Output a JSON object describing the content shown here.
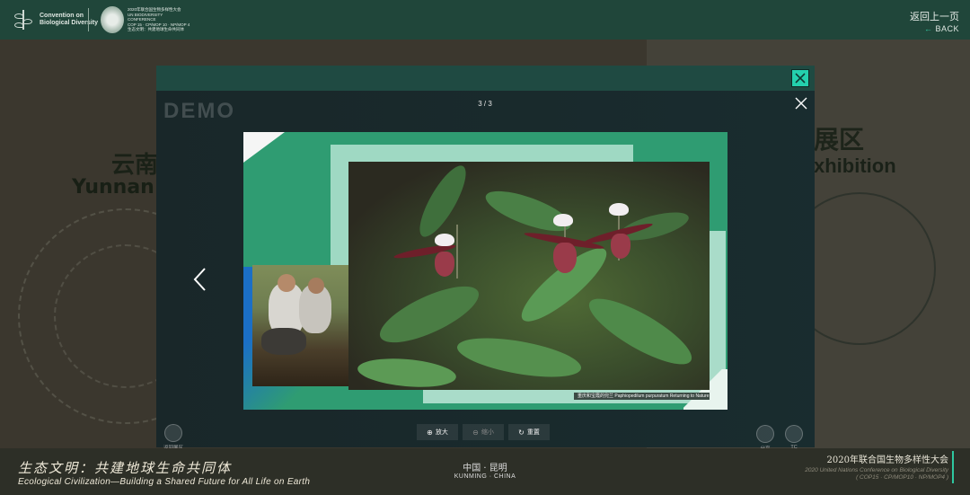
{
  "header": {
    "cbd_logo_text": [
      "Convention on",
      "Biological Diversity"
    ],
    "cop_logo_text": [
      "2020年联合国生物多样性大会",
      "UN BIODIVERSITY CONFERENCE",
      "COP 15 · CP/MOP 10 · NP/MOP 4",
      "生态文明：共建地球生命共同体"
    ],
    "back_cn": "返回上一页",
    "back_en": "BACK"
  },
  "background": {
    "left_title_cn": "云南",
    "left_title_en": "Yunnan",
    "right_title_cn": "展区",
    "right_title_en": "xhibition"
  },
  "viewer": {
    "watermark": "DEMO",
    "counter": "3 / 3",
    "caption": "重庆和宝霞的兜兰  Paphiopedilum purpuratum Returning to Nature",
    "toolbar": [
      {
        "label": "放大",
        "icon": "zoom-in-icon",
        "enabled": true
      },
      {
        "label": "缩小",
        "icon": "zoom-out-icon",
        "enabled": false
      },
      {
        "label": "重置",
        "icon": "reset-icon",
        "enabled": true
      }
    ],
    "left_label": "返回展区",
    "right_labels": [
      "分享",
      "TC"
    ]
  },
  "footer": {
    "slogan_cn": "生态文明：共建地球生命共同体",
    "slogan_en": "Ecological Civilization—Building a Shared Future for All Life on Earth",
    "city_cn": "中国 · 昆明",
    "city_en": "KUNMING · CHINA",
    "conference_cn": "2020年联合国生物多样性大会",
    "conference_en": "2020 United Nations Conference on Biological Diversity",
    "conference_sub": "( COP15 · CP/MOP10 · NP/MOP4 )"
  },
  "colors": {
    "header_bg": "#20463a",
    "accent_teal": "#24d0ad",
    "panel_green": "#2f9c72",
    "panel_blue": "#1b6fc6"
  }
}
